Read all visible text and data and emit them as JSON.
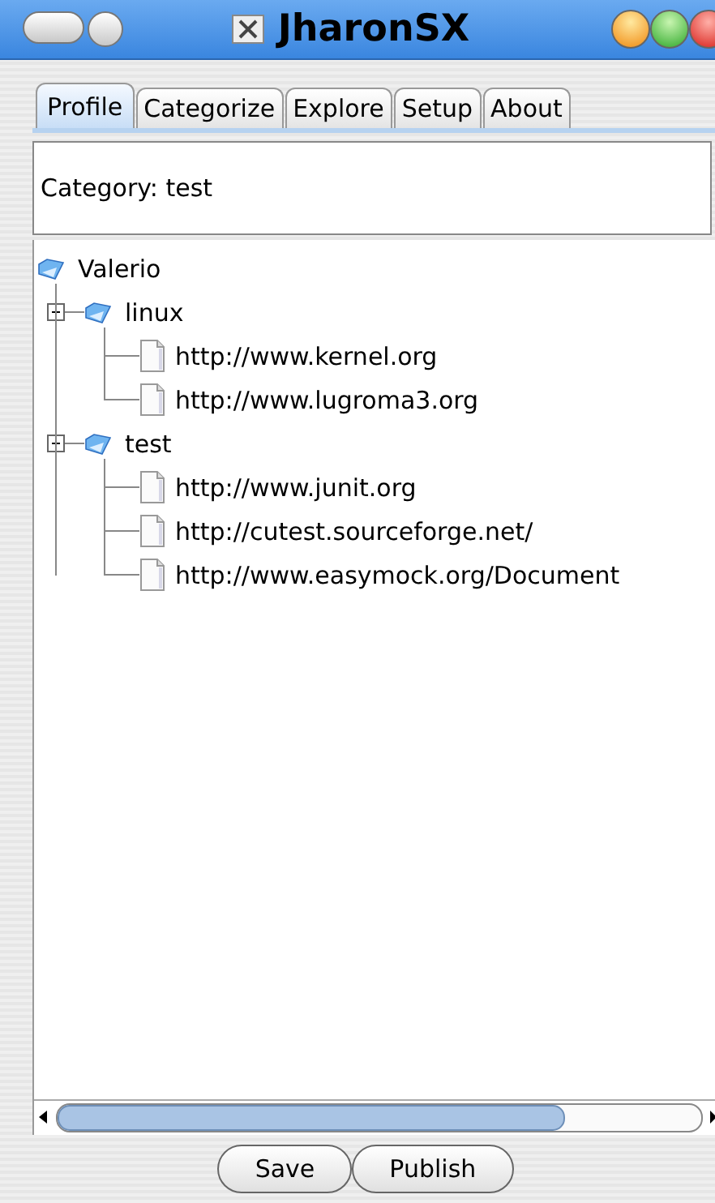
{
  "window": {
    "title": "JharonSX"
  },
  "tabs": [
    {
      "label": "Profile",
      "selected": true
    },
    {
      "label": "Categorize",
      "selected": false
    },
    {
      "label": "Explore",
      "selected": false
    },
    {
      "label": "Setup",
      "selected": false
    },
    {
      "label": "About",
      "selected": false
    }
  ],
  "category_panel": {
    "text": "Category: test"
  },
  "tree": {
    "label": "Valerio",
    "kind": "folder",
    "children": [
      {
        "label": "linux",
        "kind": "folder",
        "expanded": true,
        "children": [
          {
            "label": "http://www.kernel.org",
            "kind": "link"
          },
          {
            "label": "http://www.lugroma3.org",
            "kind": "link"
          }
        ]
      },
      {
        "label": "test",
        "kind": "folder",
        "expanded": true,
        "children": [
          {
            "label": "http://www.junit.org",
            "kind": "link"
          },
          {
            "label": "http://cutest.sourceforge.net/",
            "kind": "link"
          },
          {
            "label": "http://www.easymock.org/Document",
            "kind": "link"
          }
        ]
      }
    ]
  },
  "buttons": [
    {
      "label": "Save"
    },
    {
      "label": "Publish"
    }
  ]
}
